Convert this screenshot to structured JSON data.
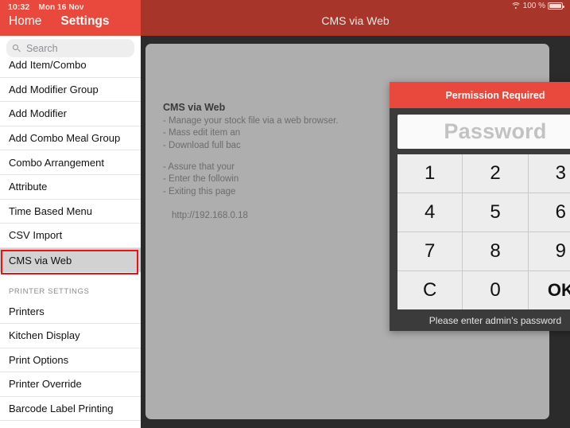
{
  "status_bar": {
    "time": "10:32",
    "date": "Mon 16 Nov",
    "wifi_icon": "wifi-icon",
    "battery_percent": "100 %",
    "battery_icon": "battery-full-icon"
  },
  "sidebar": {
    "nav": {
      "home_label": "Home",
      "settings_label": "Settings"
    },
    "search": {
      "placeholder": "Search",
      "value": "",
      "icon": "search-icon"
    },
    "items": [
      {
        "label": "Add Item/Combo",
        "selected": false
      },
      {
        "label": "Add Modifier Group",
        "selected": false
      },
      {
        "label": "Add Modifier",
        "selected": false
      },
      {
        "label": "Add Combo Meal Group",
        "selected": false
      },
      {
        "label": "Combo Arrangement",
        "selected": false
      },
      {
        "label": "Attribute",
        "selected": false
      },
      {
        "label": "Time Based Menu",
        "selected": false
      },
      {
        "label": "CSV Import",
        "selected": false
      },
      {
        "label": "CMS via Web",
        "selected": true
      }
    ],
    "section_header": "PRINTER SETTINGS",
    "printer_items": [
      {
        "label": "Printers"
      },
      {
        "label": "Kitchen Display"
      },
      {
        "label": "Print Options"
      },
      {
        "label": "Printer Override"
      },
      {
        "label": "Barcode Label Printing"
      }
    ]
  },
  "topbar": {
    "title": "CMS via Web"
  },
  "content": {
    "heading": "CMS via Web",
    "bullets_top": "- Manage your stock file via a web browser.\n- Mass edit item an\n- Download full bac",
    "bullets_bottom": "- Assure that your \n- Enter the followin\n- Exiting this page ",
    "url": "http://192.168.0.18",
    "toggle": {
      "name": "cms-web-toggle",
      "state": "off"
    }
  },
  "dialog": {
    "title": "Permission Required",
    "password_placeholder": "Password",
    "password_value": "",
    "keys": [
      "1",
      "2",
      "3",
      "4",
      "5",
      "6",
      "7",
      "8",
      "9",
      "C",
      "0",
      "OK"
    ],
    "footer": "Please enter admin's password"
  },
  "colors": {
    "sidebar_red": "#e8493c",
    "topbar_red": "#a83529",
    "dialog_red": "#e8493c",
    "panel_grey": "#aeaeae",
    "selection_outline": "#ee1111"
  }
}
